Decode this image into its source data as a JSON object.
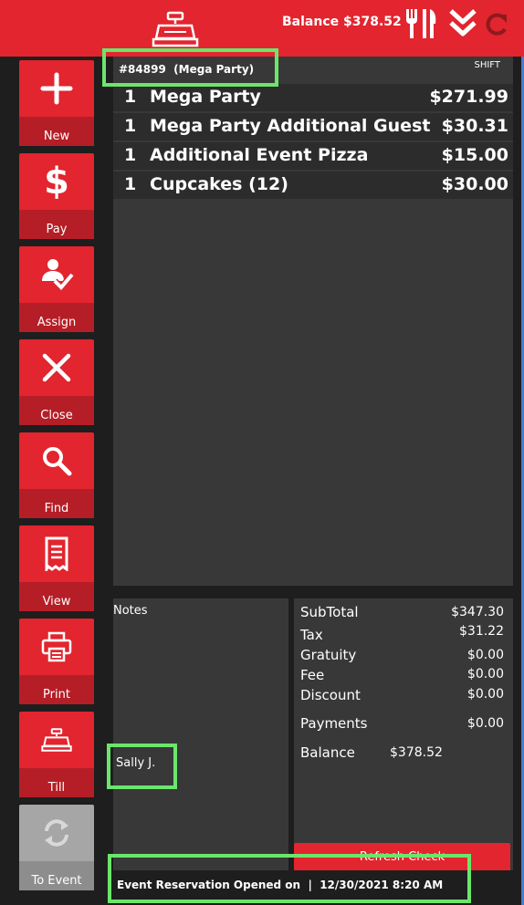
{
  "header": {
    "balance_text": "Balance $378.52",
    "icons": [
      "cash-register-icon",
      "fork-knife-icon",
      "double-chevron-down-icon",
      "refresh-icon"
    ]
  },
  "sidebar": {
    "items": [
      {
        "label": "New",
        "icon": "plus-icon"
      },
      {
        "label": "Pay",
        "icon": "dollar-icon"
      },
      {
        "label": "Assign",
        "icon": "assign-user-icon"
      },
      {
        "label": "Close",
        "icon": "close-icon"
      },
      {
        "label": "Find",
        "icon": "search-icon"
      },
      {
        "label": "View",
        "icon": "receipt-icon"
      },
      {
        "label": "Print",
        "icon": "printer-icon"
      },
      {
        "label": "Till",
        "icon": "cash-register-icon"
      },
      {
        "label": "To Event",
        "icon": "sync-icon"
      }
    ]
  },
  "order": {
    "id_text": "#84899  (Mega Party)",
    "shift_label": "SHIFT",
    "items": [
      {
        "qty": "1",
        "name": "Mega Party",
        "price": "$271.99"
      },
      {
        "qty": "1",
        "name": "Mega Party Additional Guest",
        "price": "$30.31"
      },
      {
        "qty": "1",
        "name": "Additional Event Pizza",
        "price": "$15.00"
      },
      {
        "qty": "1",
        "name": "Cupcakes (12)",
        "price": "$30.00"
      }
    ]
  },
  "notes": {
    "label": "Notes",
    "user": "Sally  J."
  },
  "totals": {
    "subtotal_label": "SubTotal",
    "subtotal": "$347.30",
    "tax_label": "Tax",
    "tax": "$31.22",
    "gratuity_label": "Gratuity",
    "gratuity": "$0.00",
    "fee_label": "Fee",
    "fee": "$0.00",
    "discount_label": "Discount",
    "discount": "$0.00",
    "payments_label": "Payments",
    "payments": "$0.00",
    "balance_label": "Balance",
    "balance": "$378.52",
    "refresh_label": "Refresh Check"
  },
  "footer": {
    "text": "Event Reservation Opened on  |  12/30/2021 8:20 AM"
  },
  "colors": {
    "accent": "#e2252e",
    "accent_dark": "#b51e26",
    "panel": "#383838",
    "background": "#1e1e1e",
    "highlight": "#6be66b"
  }
}
